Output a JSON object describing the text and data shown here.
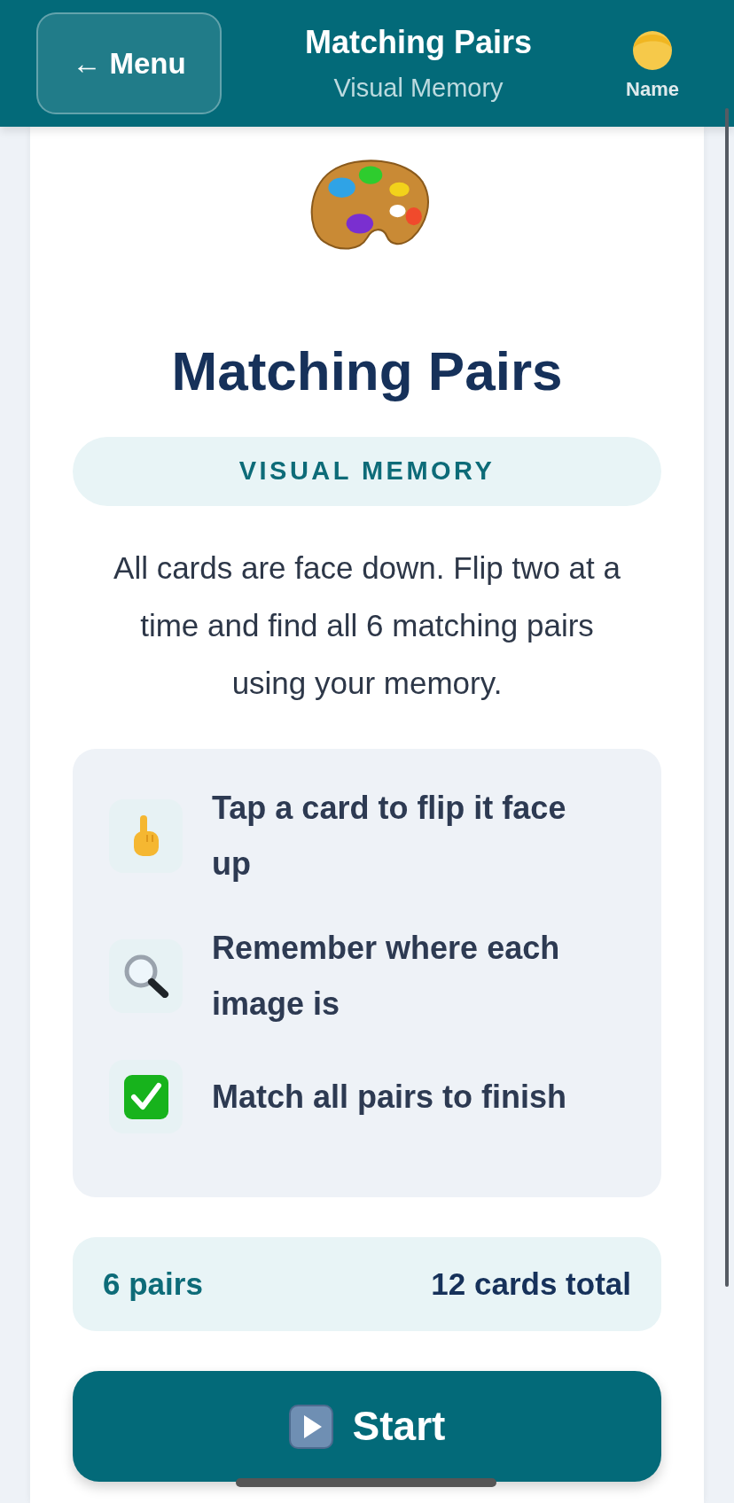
{
  "header": {
    "back_button": "← Menu",
    "title": "Matching Pairs",
    "subtitle": "Visual Memory",
    "user": {
      "name": "Name"
    }
  },
  "game": {
    "title": "Matching Pairs",
    "category": "VISUAL MEMORY",
    "description": "All cards are face down. Flip two at a time and find all 6 matching pairs using your memory.",
    "steps": [
      {
        "kind": "tap",
        "text": "Tap a card to flip it face up"
      },
      {
        "kind": "search",
        "text": "Remember where each image is"
      },
      {
        "kind": "check",
        "text": "Match all pairs to finish"
      }
    ],
    "stats": {
      "pairs": "6 pairs",
      "total": "12 cards total"
    },
    "start_button": "Start"
  }
}
